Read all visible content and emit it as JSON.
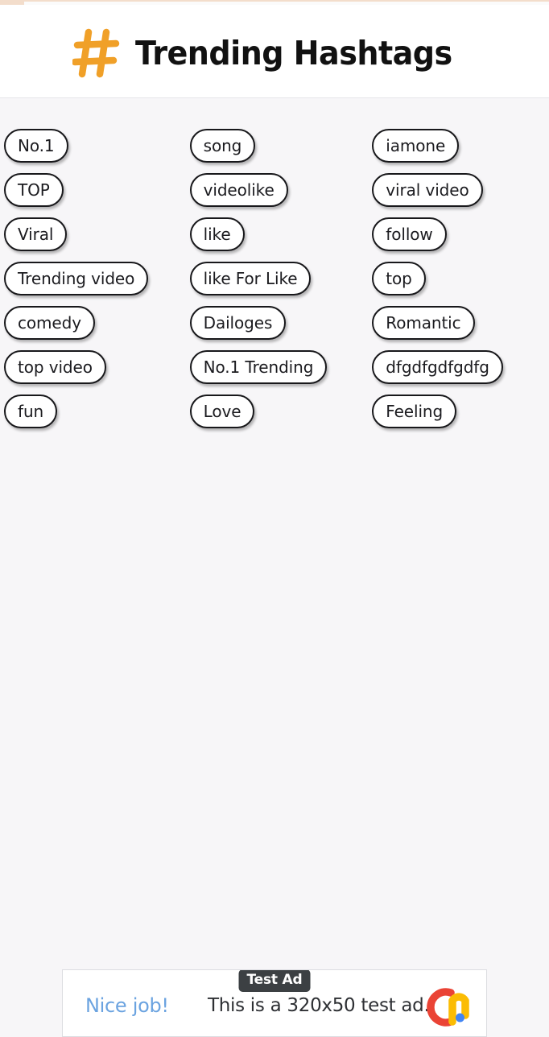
{
  "header": {
    "title": "Trending Hashtags",
    "icon": "hash-icon",
    "icon_color": "#f0a028",
    "title_color": "#111111",
    "background": "#ffffff"
  },
  "theme": {
    "page_background": "#f7f6f8",
    "chip_background": "#ffffff",
    "chip_border": "#18181b",
    "chip_text": "#1b1b1f",
    "top_strip": "#f3ddcb"
  },
  "hashtag_columns": [
    {
      "column": 1,
      "chips": [
        {
          "label": "No.1"
        },
        {
          "label": "TOP"
        },
        {
          "label": "Viral"
        },
        {
          "label": "Trending video"
        },
        {
          "label": "comedy"
        },
        {
          "label": "top video"
        },
        {
          "label": "fun"
        }
      ]
    },
    {
      "column": 2,
      "chips": [
        {
          "label": "song"
        },
        {
          "label": "videolike"
        },
        {
          "label": "like"
        },
        {
          "label": "like For Like"
        },
        {
          "label": "Dailoges"
        },
        {
          "label": "No.1 Trending"
        },
        {
          "label": "Love"
        }
      ]
    },
    {
      "column": 3,
      "chips": [
        {
          "label": "iamone"
        },
        {
          "label": "viral video"
        },
        {
          "label": "follow"
        },
        {
          "label": "top"
        },
        {
          "label": "Romantic"
        },
        {
          "label": "dfgdfgdfgdfg"
        },
        {
          "label": "Feeling"
        }
      ]
    }
  ],
  "ad": {
    "badge": "Test Ad",
    "cta": "Nice job!",
    "body": "This is a 320x50 test ad.",
    "logo": "admob-icon",
    "badge_background": "#3c4043",
    "cta_color": "#6ba3e0",
    "logo_colors": {
      "red": "#ea4335",
      "yellow": "#fbbc04",
      "blue": "#4285f4"
    }
  }
}
